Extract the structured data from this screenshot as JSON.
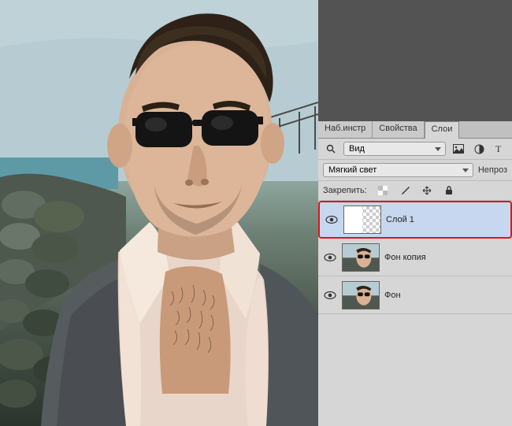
{
  "tabs": {
    "presets": "Наб.инстр",
    "properties": "Свойства",
    "layers": "Слои"
  },
  "filter": {
    "label": "Вид"
  },
  "blend": {
    "mode": "Мягкий свет",
    "opacity_label": "Непроз"
  },
  "lock": {
    "label": "Закрепить:"
  },
  "layers_list": [
    {
      "name": "Слой 1",
      "selected": true,
      "thumb": "checker"
    },
    {
      "name": "Фон копия",
      "selected": false,
      "thumb": "photo"
    },
    {
      "name": "Фон",
      "selected": false,
      "thumb": "photo"
    }
  ]
}
